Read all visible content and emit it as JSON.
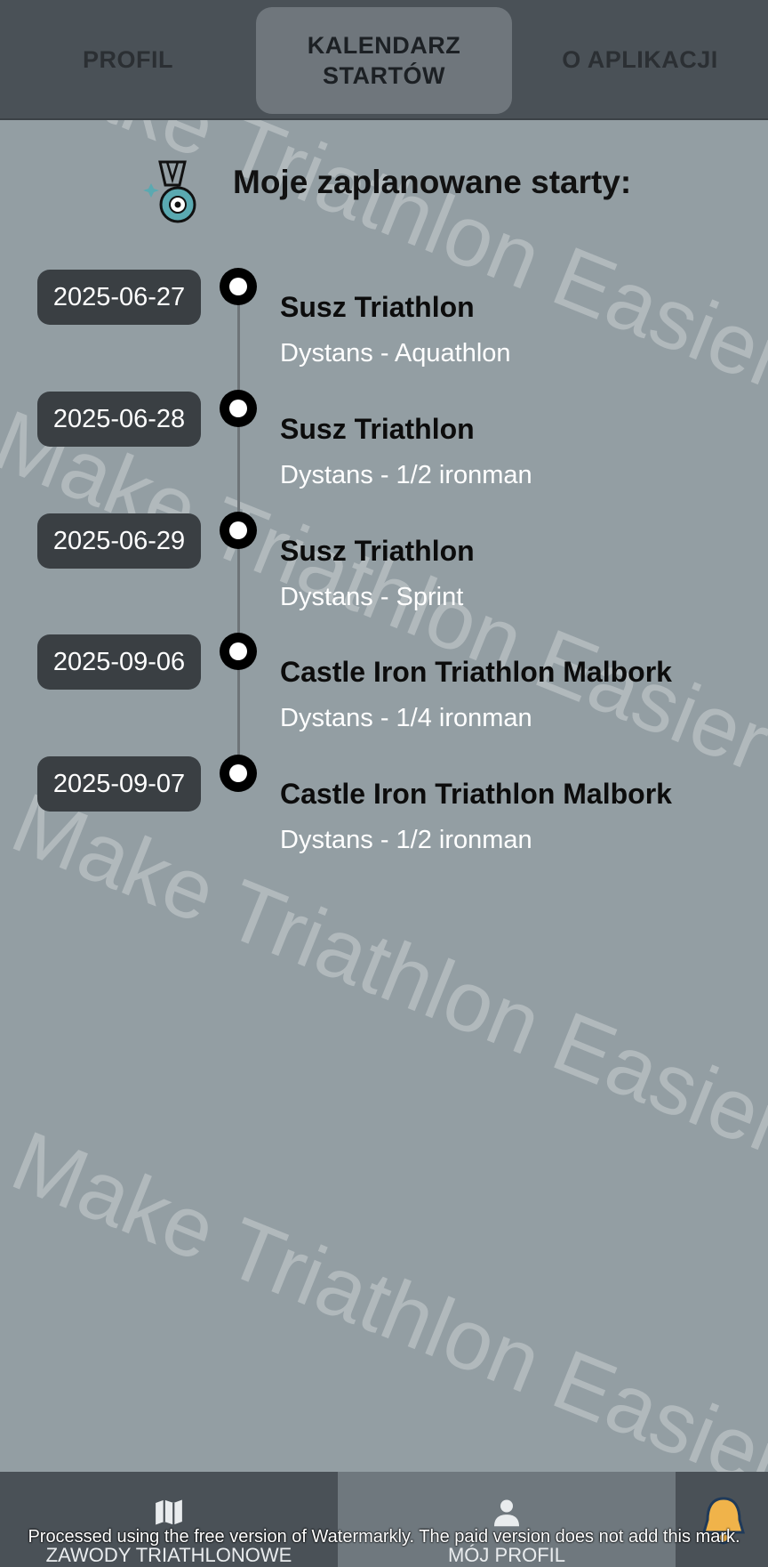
{
  "tabs": {
    "profil": "PROFIL",
    "kalendarz": "KALENDARZ STARTÓW",
    "o_aplikacji": "O APLIKACJI"
  },
  "header": {
    "icon": "medal-icon",
    "title": "Moje zaplanowane starty:"
  },
  "events": [
    {
      "date": "2025-06-27",
      "name": "Susz Triathlon",
      "distance": "Dystans - Aquathlon"
    },
    {
      "date": "2025-06-28",
      "name": "Susz Triathlon",
      "distance": "Dystans - 1/2 ironman"
    },
    {
      "date": "2025-06-29",
      "name": "Susz Triathlon",
      "distance": "Dystans - Sprint"
    },
    {
      "date": "2025-09-06",
      "name": "Castle Iron Triathlon Malbork",
      "distance": "Dystans - 1/4 ironman"
    },
    {
      "date": "2025-09-07",
      "name": "Castle Iron Triathlon Malbork",
      "distance": "Dystans - 1/2 ironman"
    }
  ],
  "watermark": "Make Triathlon Easier",
  "watermark_note": "Processed using the free version of Watermarkly. The paid version does not add this mark.",
  "bottom_nav": {
    "zawody": {
      "label": "ZAWODY TRIATHLONOWE",
      "icon": "map-icon"
    },
    "profil": {
      "label": "MÓJ PROFIL",
      "icon": "person-icon"
    },
    "bell_icon": "bell-icon"
  },
  "colors": {
    "background": "#939ea3",
    "bar": "#4a5157",
    "active_tab": "#6f767c",
    "date_badge": "#3a3f43"
  }
}
